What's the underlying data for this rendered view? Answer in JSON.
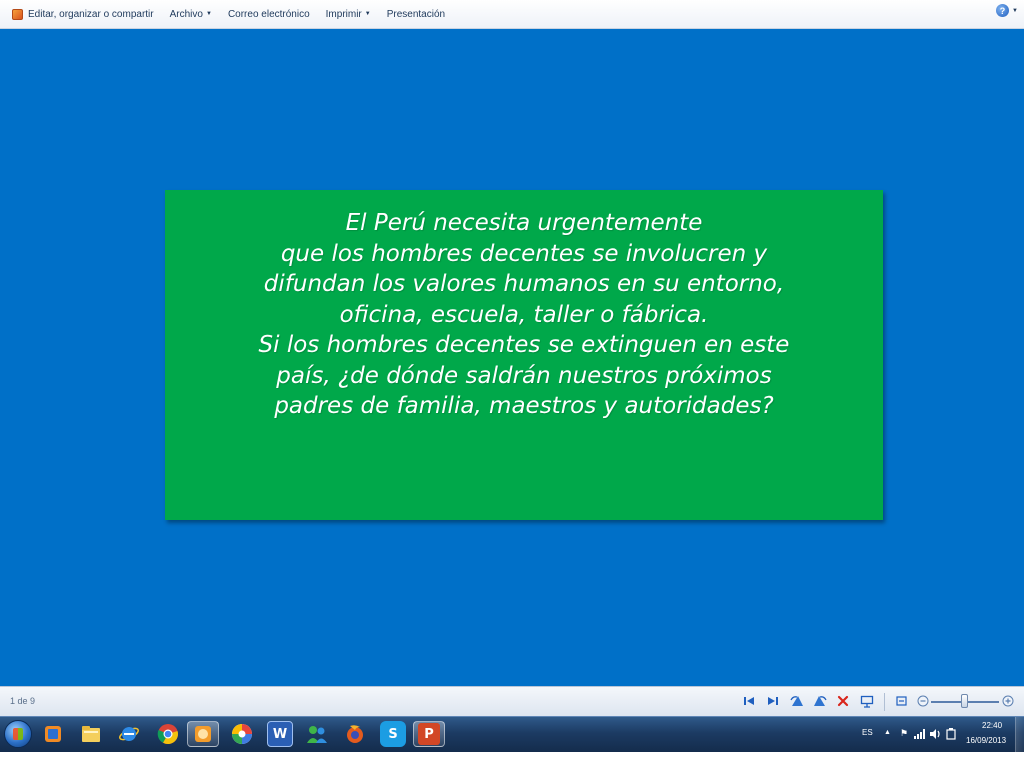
{
  "toolbar": {
    "items": [
      {
        "label": "Editar, organizar o compartir",
        "has_caret": false
      },
      {
        "label": "Archivo",
        "has_caret": true
      },
      {
        "label": "Correo electrónico",
        "has_caret": false
      },
      {
        "label": "Imprimir",
        "has_caret": true
      },
      {
        "label": "Presentación",
        "has_caret": false
      }
    ],
    "caret_glyph": "▼",
    "help_glyph": "?"
  },
  "slide": {
    "background_color": "#0070c8",
    "box_color": "#00a84a",
    "lines": [
      "El Perú necesita urgentemente",
      "que los hombres decentes se involucren y",
      "difundan los valores humanos en su entorno,",
      "oficina, escuela, taller o fábrica.",
      "Si los hombres decentes se extinguen en este",
      "país, ¿de dónde saldrán nuestros próximos",
      "padres de familia, maestros y autoridades?"
    ]
  },
  "controls": {
    "page_counter": "1 de 9",
    "buttons": [
      "previous-icon",
      "next-icon",
      "rotate-left-icon",
      "rotate-right-icon",
      "delete-icon",
      "slideshow-icon",
      "actual-size-icon",
      "zoom-out-icon",
      "zoom-slider",
      "zoom-in-icon"
    ],
    "delete_color": "#d9261c",
    "zoom_out_glyph": "−",
    "zoom_in_glyph": "+"
  },
  "taskbar": {
    "pinned": [
      "start-orb",
      "media-player-icon",
      "file-explorer-icon",
      "internet-explorer-icon",
      "chrome-icon",
      "photo-viewer-icon",
      "picasa-icon",
      "word-icon",
      "messenger-icon",
      "firefox-icon",
      "skype-icon",
      "powerpoint-icon"
    ],
    "word_glyph": "W",
    "skype_glyph": "S",
    "powerpoint_glyph": "P",
    "language": "ES",
    "time": "22:40",
    "date": "16/09/2013"
  }
}
